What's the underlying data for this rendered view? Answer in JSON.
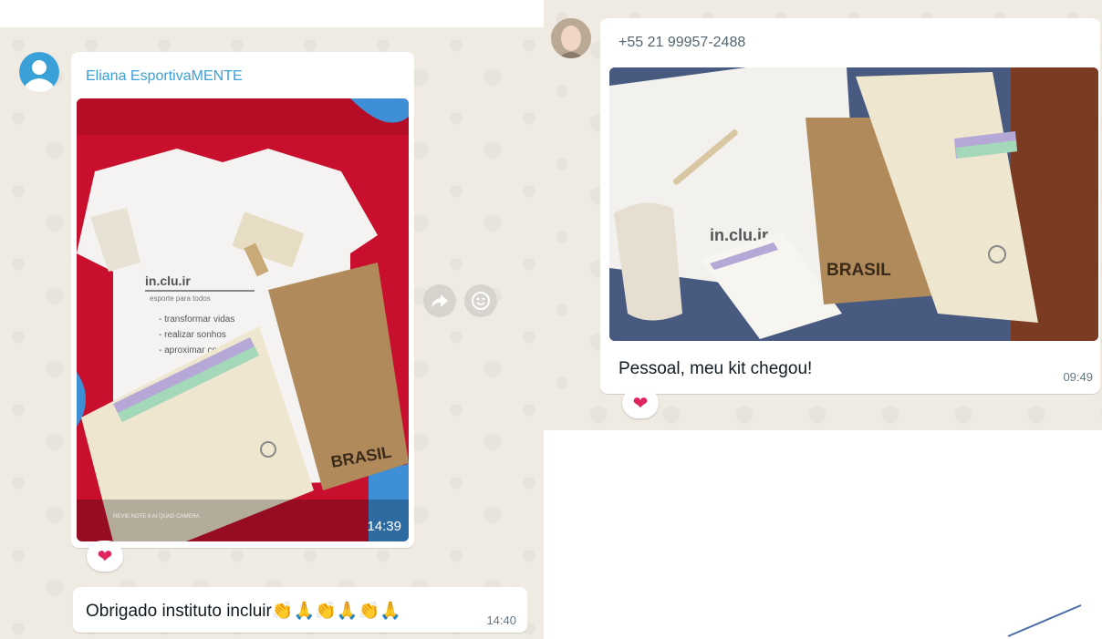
{
  "left_chat": {
    "sender_name": "Eliana EsportivaMENTE",
    "image_time": "14:39",
    "image_caption_small": "REVIE NOTE 8 AI QUAD CAMERA",
    "reaction": "❤",
    "reply_text": "Obrigado instituto incluir👏🙏👏🙏👏🙏",
    "reply_time": "14:40",
    "photo_text": {
      "shirt_brand": "in.clu.ir",
      "shirt_tagline": "esporte para todos",
      "shirt_line1": "- transformar vidas",
      "shirt_line2": "- realizar sonhos",
      "shirt_line3": "- aproximar corações",
      "folder_brand": "BRASIL"
    }
  },
  "right_chat": {
    "sender_phone": "+55 21 99957-2488",
    "caption": "Pessoal, meu kit chegou!",
    "time": "09:49",
    "reaction": "❤",
    "photo_text": {
      "shirt_brand": "in.clu.ir",
      "folder_brand": "BRASIL"
    }
  },
  "actions": {
    "forward_icon": "forward-icon",
    "emoji_icon": "emoji-icon"
  },
  "colors": {
    "sender_left": "#3aa0d8",
    "sender_right": "#54656f",
    "chat_bg": "#efeae2",
    "heart": "#e0245e"
  }
}
